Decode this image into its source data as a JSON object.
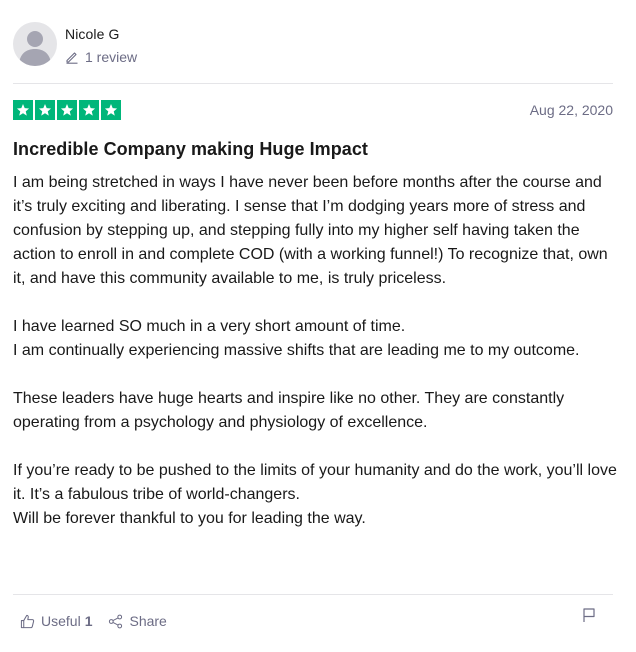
{
  "reviewer": {
    "name": "Nicole G",
    "review_count": "1 review",
    "avatar_icon": "user-silhouette-icon"
  },
  "review": {
    "rating": 5,
    "rating_max": 5,
    "date": "Aug 22, 2020",
    "title": "Incredible Company making Huge Impact",
    "paragraphs": [
      "I am being stretched in ways I have never been before months after the course and it’s truly exciting and liberating. I sense that I’m dodging years more of stress and confusion by stepping up, and stepping fully into my higher self having taken the action to enroll in and complete COD (with a working funnel!) To recognize that, own it, and have this community available to me, is truly priceless.",
      "I have learned SO much in a very short amount of time.\nI am continually experiencing massive shifts that are leading me to my outcome.",
      "These leaders have huge hearts and inspire like no other. They are constantly operating from a psychology and physiology of excellence.",
      "If you’re ready to be pushed to the limits of your humanity and do the work, you’ll love it. It’s a fabulous tribe of world-changers.\nWill be forever thankful to you for leading the way."
    ]
  },
  "actions": {
    "useful_label": "Useful",
    "useful_count": "1",
    "share_label": "Share",
    "useful_icon": "thumbs-up-icon",
    "share_icon": "share-icon",
    "flag_icon": "flag-icon"
  },
  "colors": {
    "star_green": "#00b67a",
    "muted_text": "#6c6c85",
    "divider": "#e5e5e8"
  }
}
